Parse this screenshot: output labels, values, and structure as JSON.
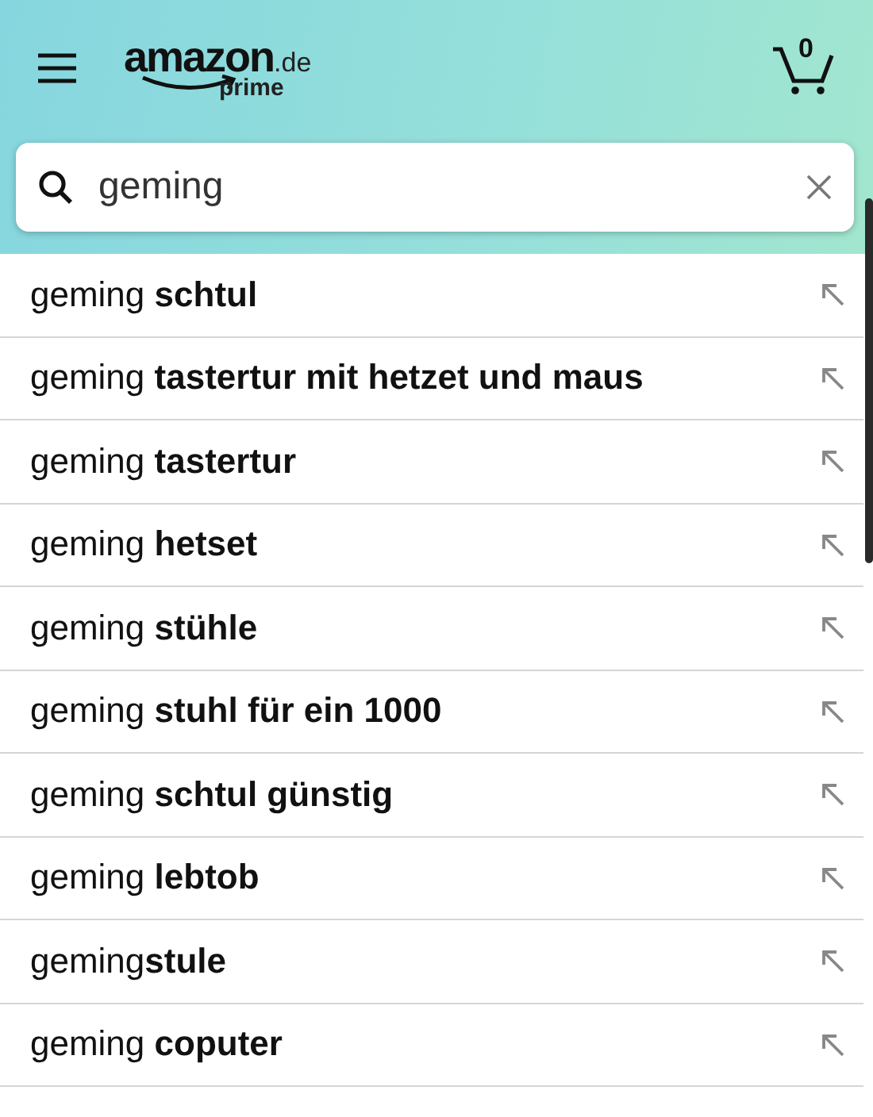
{
  "header": {
    "logo": {
      "brand": "amazon",
      "domain": ".de",
      "tier": "prime"
    },
    "cart_count": "0"
  },
  "search": {
    "value": "geming"
  },
  "suggestions": [
    {
      "text": "geming **schtul**"
    },
    {
      "text": "geming **tastertur mit hetzet und maus**"
    },
    {
      "text": "geming **tastertur**"
    },
    {
      "text": "geming **hetset**"
    },
    {
      "text": "geming **stühle**"
    },
    {
      "text": "geming **stuhl für ein 1000**"
    },
    {
      "text": "geming **schtul günstig**"
    },
    {
      "text": "geming **lebtob**"
    },
    {
      "text": "geming**stule**"
    },
    {
      "text": "geming **coputer**"
    }
  ]
}
